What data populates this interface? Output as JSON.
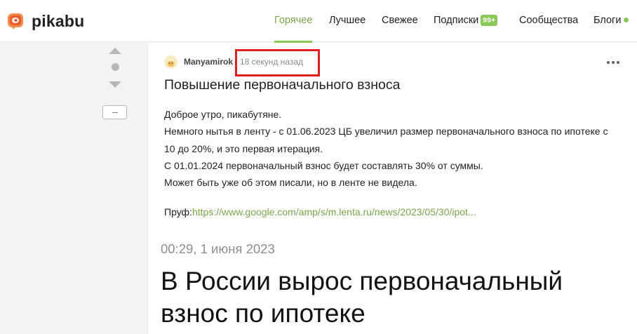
{
  "header": {
    "logo_text": "pikabu",
    "nav": [
      {
        "label": "Горячее",
        "active": true
      },
      {
        "label": "Лучшее"
      },
      {
        "label": "Свежее"
      },
      {
        "label": "Подписки",
        "badge": "99+"
      },
      {
        "label": "Сообщества"
      },
      {
        "label": "Блоги",
        "status_dot": true
      }
    ]
  },
  "post": {
    "author": "Manyamirok",
    "time": "18 секунд назад",
    "title": "Повышение первоначального взноса",
    "text": [
      "Доброе утро, пикабутяне.",
      "Немного нытья в ленту - с 01.06.2023 ЦБ увеличил размер первоначального взноса по ипотеке с",
      "10 до 20%, и это первая итерация.",
      "С 01.01.2024 первоначальный взнос будет составлять 30% от суммы.",
      "Может быть уже об этом писали, но в ленте не видела."
    ],
    "proof_label": "Пруф:",
    "proof_link": "https://www.google.com/amp/s/m.lenta.ru/news/2023/05/30/ipot...",
    "article_date": "00:29, 1 июня 2023",
    "article_title": "В России вырос первоначальный взнос по ипотеке"
  },
  "colors": {
    "accent": "#8ac858",
    "highlight_box": "#e02020",
    "logo_orange": "#f06529"
  },
  "icons": [
    "pikabu-logo-icon",
    "vote-up-icon",
    "vote-down-icon",
    "collapse-icon",
    "more-options-icon"
  ]
}
